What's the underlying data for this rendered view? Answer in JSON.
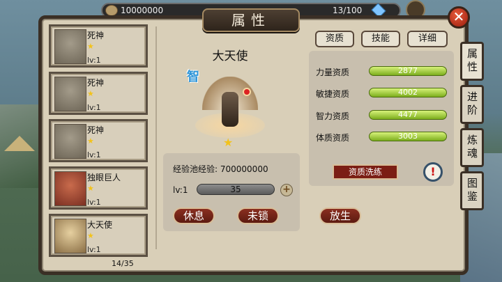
{
  "window_title": "属性",
  "close_icon": "close-icon",
  "topbar": {
    "gold": "10000000",
    "gems": "13/100"
  },
  "hero_list": [
    {
      "name": "死神",
      "level": "lv:1",
      "portrait": "grey"
    },
    {
      "name": "死神",
      "level": "lv:1",
      "portrait": "grey"
    },
    {
      "name": "死神",
      "level": "lv:1",
      "portrait": "grey"
    },
    {
      "name": "独眼巨人",
      "level": "lv:1",
      "portrait": "red"
    },
    {
      "name": "大天使",
      "level": "lv:1",
      "portrait": "gold"
    }
  ],
  "list_count": "14/35",
  "hero": {
    "name": "大天使",
    "class_badge": "智",
    "exp_pool_label": "经验池经验:",
    "exp_pool_value": "700000000",
    "level_label": "lv:1",
    "exp_value": "35",
    "rest_label": "休息",
    "unlock_label": "未锁",
    "release_label": "放生"
  },
  "tabs": [
    "资质",
    "技能",
    "详细"
  ],
  "stats": [
    {
      "label": "力量资质",
      "value": "2877"
    },
    {
      "label": "敏捷资质",
      "value": "4002"
    },
    {
      "label": "智力资质",
      "value": "4477"
    },
    {
      "label": "体质资质",
      "value": "3003"
    }
  ],
  "wash_label": "资质洗练",
  "warn_label": "!",
  "side_tabs": [
    "属性",
    "进阶",
    "炼魂",
    "图鉴"
  ]
}
